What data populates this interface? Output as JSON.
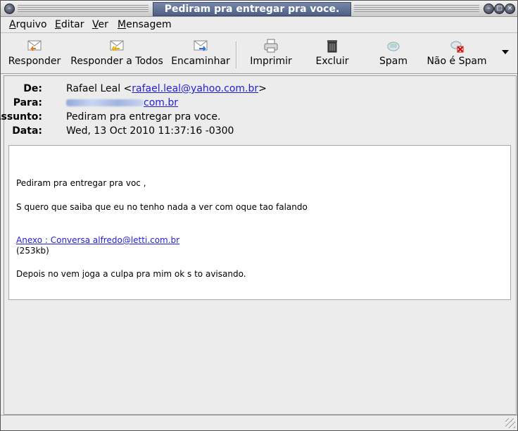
{
  "window": {
    "title": "Pediram pra entregar pra voce."
  },
  "menu": {
    "arquivo": {
      "u": "A",
      "rest": "rquivo"
    },
    "editar": {
      "u": "E",
      "rest": "ditar"
    },
    "ver": {
      "u": "V",
      "rest": "er"
    },
    "mensagem": {
      "u": "M",
      "rest": "ensagem"
    }
  },
  "toolbar": {
    "reply": "Responder",
    "reply_all": "Responder a Todos",
    "forward": "Encaminhar",
    "print": "Imprimir",
    "delete": "Excluir",
    "spam": "Spam",
    "not_spam": "Não é Spam"
  },
  "header": {
    "from_label": "De:",
    "from_name": "Rafael Leal <",
    "from_email": "rafael.leal@yahoo.com.br",
    "from_close": ">",
    "to_label": "Para:",
    "to_value": "com.br",
    "subject_label": "Assunto:",
    "subject": "Pediram pra entregar pra voce.",
    "date_label": "Data:",
    "date": "Wed, 13 Oct 2010 11:37:16 -0300"
  },
  "body": {
    "line1": "Pediram pra entregar pra voc ,",
    "line2": "S quero que saiba que eu no tenho nada a ver com oque tao falando",
    "attachment_link": "Anexo : Conversa alfredo@letti.com.br",
    "attachment_size": "(253kb)",
    "line3": "Depois no vem joga a culpa pra mim ok s to avisando."
  }
}
